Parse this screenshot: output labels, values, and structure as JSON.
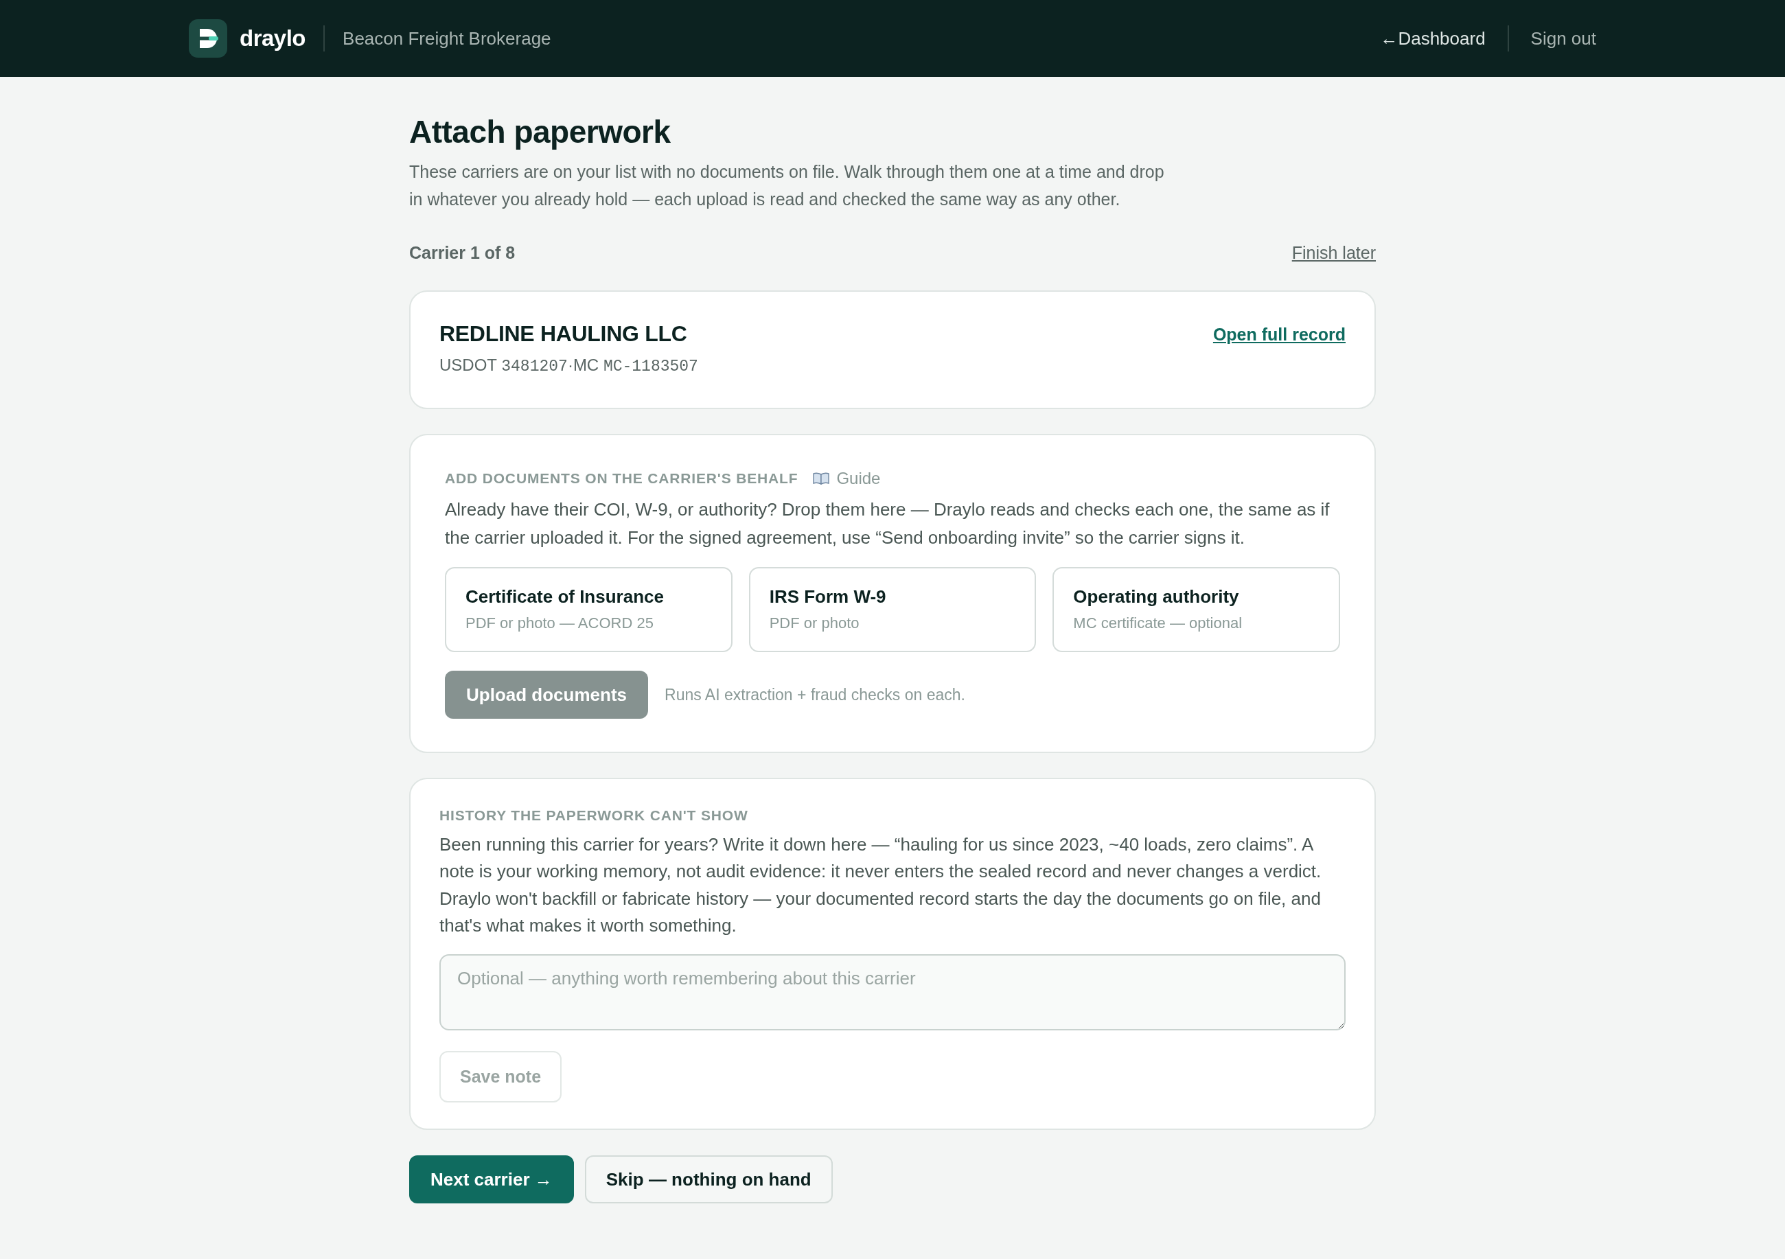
{
  "header": {
    "brand": "draylo",
    "company": "Beacon Freight Brokerage",
    "links": [
      {
        "label": "←Dashboard",
        "kind": "back"
      },
      {
        "label": "Sign out",
        "kind": "plain"
      }
    ]
  },
  "title": "Attach paperwork",
  "intro": "These carriers are on your list with no documents on file. Walk through them one at a time and drop in whatever you already hold — each upload is read and checked the same way as any other.",
  "progress": {
    "label": "Carrier 1 of 8",
    "finish_link": "Finish later"
  },
  "carrier": {
    "name": "REDLINE HAULING LLC",
    "identifiers": [
      {
        "label": "USDOT",
        "number": "3481207"
      },
      {
        "label": "MC",
        "number": "MC-1183507"
      }
    ],
    "separator": "·",
    "record_link": "Open full record"
  },
  "documents": {
    "heading": "ADD DOCUMENTS ON THE CARRIER'S BEHALF",
    "guide_link": "Guide",
    "description": "Already have their COI, W-9, or authority? Drop them here — Draylo reads and checks each one, the same as if the carrier uploaded it. For the signed agreement, use “Send onboarding invite” so the carrier signs it.",
    "slots": [
      {
        "title": "Certificate of Insurance",
        "hint": "PDF or photo — ACORD 25"
      },
      {
        "title": "IRS Form W-9",
        "hint": "PDF or photo"
      },
      {
        "title": "Operating authority",
        "hint": "MC certificate — optional"
      }
    ],
    "upload_button": {
      "label": "Upload documents",
      "disabled": true
    },
    "upload_note": "Runs AI extraction + fraud checks on each."
  },
  "history": {
    "heading": "HISTORY THE PAPERWORK CAN'T SHOW",
    "description": "Been running this carrier for years? Write it down here — “hauling for us since 2023, ~40 loads, zero claims”. A note is your working memory, not audit evidence: it never enters the sealed record and never changes a verdict. Draylo won't backfill or fabricate history — your documented record starts the day the documents go on file, and that's what makes it worth something.",
    "note": {
      "placeholder": "Optional — anything worth remembering about this carrier"
    },
    "save_button": {
      "label": "Save note",
      "disabled": true
    }
  },
  "actions": [
    {
      "label": "Next carrier →",
      "kind": "primary"
    },
    {
      "label": "Skip — nothing on hand",
      "kind": "secondary"
    }
  ]
}
